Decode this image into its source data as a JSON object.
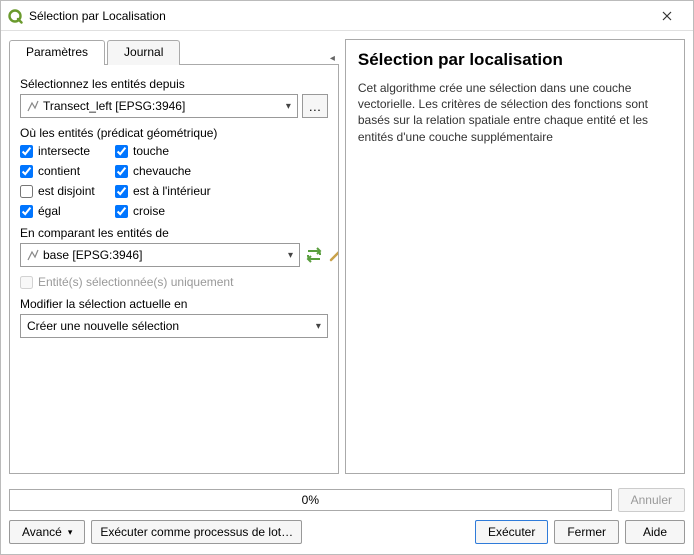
{
  "window": {
    "title": "Sélection par Localisation"
  },
  "tabs": {
    "params": "Paramètres",
    "log": "Journal"
  },
  "select_from": {
    "label": "Sélectionnez les entités depuis",
    "value": "Transect_left [EPSG:3946]",
    "browse": "…"
  },
  "predicates": {
    "label": "Où les entités (prédicat géométrique)",
    "intersects": "intersecte",
    "touches": "touche",
    "contains": "contient",
    "overlaps": "chevauche",
    "disjoint": "est disjoint",
    "within": "est à l'intérieur",
    "equals": "égal",
    "crosses": "croise",
    "checked": {
      "intersects": true,
      "touches": true,
      "contains": true,
      "overlaps": true,
      "disjoint": false,
      "within": true,
      "equals": true,
      "crosses": true
    }
  },
  "compare": {
    "label": "En comparant les entités de",
    "value": "base [EPSG:3946]",
    "browse": "…",
    "selected_only": "Entité(s) sélectionnée(s) uniquement"
  },
  "modify": {
    "label": "Modifier la sélection actuelle en",
    "value": "Créer une nouvelle sélection"
  },
  "help": {
    "title": "Sélection par localisation",
    "body": "Cet algorithme crée une sélection dans une couche vectorielle. Les critères de sélection des fonctions sont basés sur la relation spatiale entre chaque entité et les entités d'une couche supplémentaire"
  },
  "progress": {
    "text": "0%"
  },
  "buttons": {
    "cancel": "Annuler",
    "advanced": "Avancé",
    "batch": "Exécuter comme processus de lot…",
    "run": "Exécuter",
    "close": "Fermer",
    "help": "Aide"
  }
}
